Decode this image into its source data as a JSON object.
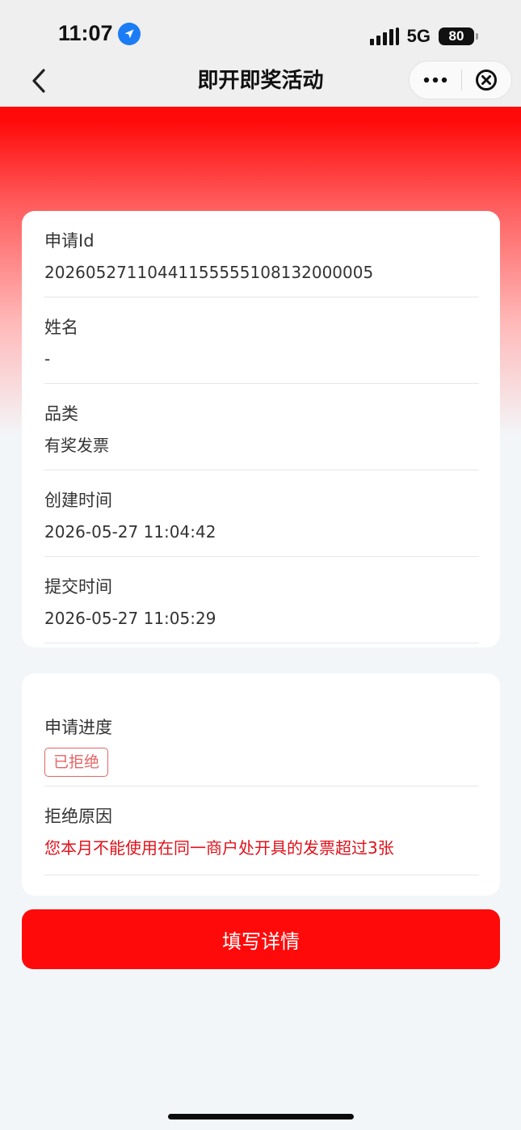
{
  "status_bar": {
    "time": "11:07",
    "network": "5G",
    "battery": "80"
  },
  "nav": {
    "title": "即开即奖活动"
  },
  "detail_fields": [
    {
      "label": "申请Id",
      "value": "2026052711044115555510813200​0005"
    },
    {
      "label": "姓名",
      "value": "-"
    },
    {
      "label": "品类",
      "value": "有奖发票"
    },
    {
      "label": "创建时间",
      "value": "2026-05-27 11:04:42"
    },
    {
      "label": "提交时间",
      "value": "2026-05-27 11:05:29"
    }
  ],
  "progress": {
    "label": "申请进度",
    "status": "已拒绝"
  },
  "rejection": {
    "label": "拒绝原因",
    "reason": "您本月不能使用在同一商户处开具的发票超过3张"
  },
  "actions": {
    "fill_details": "填写详情"
  },
  "colors": {
    "brand_red": "#ff0a0a",
    "reject_badge": "#e46464",
    "reason_text": "#e0111a"
  },
  "icons": {
    "location": "location-arrow-icon",
    "back": "chevron-left-icon",
    "more": "more-dots-icon",
    "close": "close-circle-icon"
  }
}
